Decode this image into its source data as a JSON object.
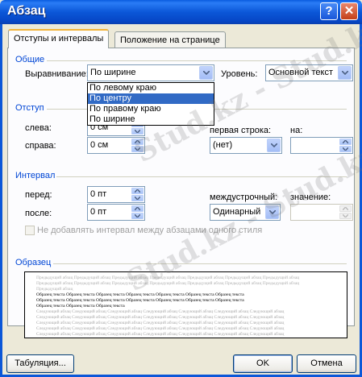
{
  "window": {
    "title": "Абзац",
    "help_glyph": "?",
    "close_glyph": "✕"
  },
  "tabs": [
    {
      "label": "Отступы и интервалы",
      "active": true
    },
    {
      "label": "Положение на странице",
      "active": false
    }
  ],
  "general": {
    "title": "Общие",
    "alignment_label": "Выравнивание:",
    "alignment_value": "По ширине",
    "alignment_options": [
      "По левому краю",
      "По центру",
      "По правому краю",
      "По ширине"
    ],
    "alignment_highlighted": "По центру",
    "level_label": "Уровень:",
    "level_value": "Основной текст"
  },
  "indent": {
    "title": "Отступ",
    "left_label": "слева:",
    "left_value": "0 см",
    "right_label": "справа:",
    "right_value": "0 см",
    "first_line_label": "первая строка:",
    "first_line_value": "(нет)",
    "by_label": "на:",
    "by_value": ""
  },
  "spacing": {
    "title": "Интервал",
    "before_label": "перед:",
    "before_value": "0 пт",
    "after_label": "после:",
    "after_value": "0 пт",
    "line_spacing_label": "междустрочный:",
    "line_spacing_value": "Одинарный",
    "at_label": "значение:",
    "at_value": "",
    "no_space_checkbox_label": "Не добавлять интервал между абзацами одного стиля"
  },
  "preview": {
    "title": "Образец",
    "prev_lines": [
      "Предыдущий абзац Предыдущий абзац Предыдущий абзац Предыдущий абзац Предыдущий абзац Предыдущий абзац Предыдущий абзац",
      "Предыдущий абзац Предыдущий абзац Предыдущий абзац Предыдущий абзац Предыдущий абзац Предыдущий абзац Предыдущий абзац",
      "Предыдущий абзац"
    ],
    "cur_lines": [
      "Образец текста Образец текста Образец текста Образец текста Образец текста Образец текста Образец текста",
      "Образец текста Образец текста Образец текста Образец текста Образец текста Образец текста Образец текста",
      "Образец текста Образец текста Образец текста"
    ],
    "next_lines": [
      "Следующий абзац Следующий абзац Следующий абзац Следующий абзац Следующий абзац Следующий абзац Следующий абзац",
      "Следующий абзац Следующий абзац Следующий абзац Следующий абзац Следующий абзац Следующий абзац Следующий абзац",
      "Следующий абзац Следующий абзац Следующий абзац Следующий абзац Следующий абзац Следующий абзац Следующий абзац",
      "Следующий абзац Следующий абзац Следующий абзац Следующий абзац Следующий абзац Следующий абзац Следующий абзац",
      "Следующий абзац Следующий абзац Следующий абзац Следующий абзац Следующий абзац Следующий абзац Следующий абзац"
    ]
  },
  "buttons": {
    "tabs": "Табуляция...",
    "ok": "OK",
    "cancel": "Отмена"
  },
  "watermark": "Stud.kz - Stud.kz",
  "colors": {
    "title_bar": "#0b57d8",
    "section_title": "#0046d5",
    "selection": "#316ac5",
    "dialog_bg": "#ece9d8"
  }
}
